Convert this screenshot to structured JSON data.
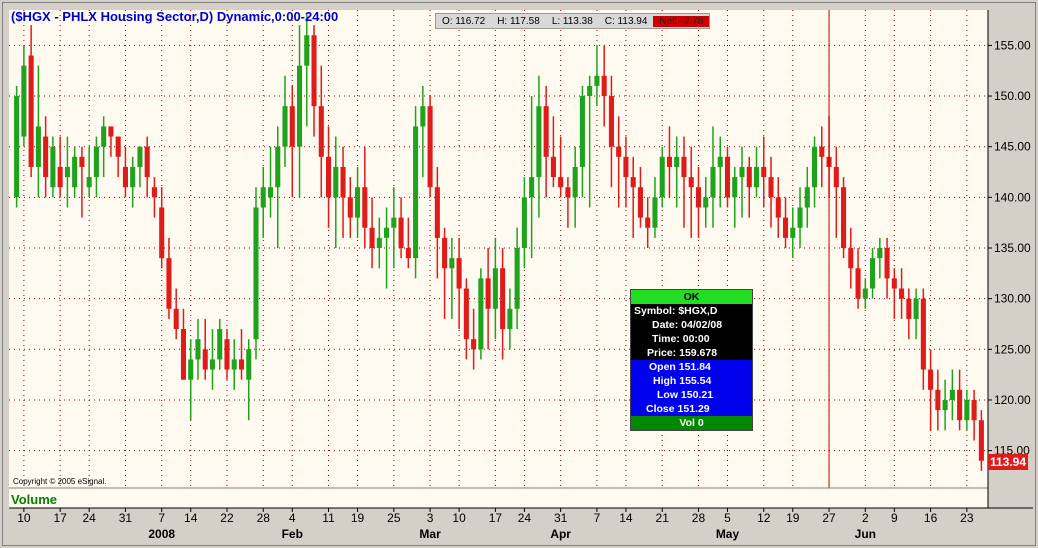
{
  "title": "($HGX - PHLX Housing Sector,D) Dynamic,0:00-24:00",
  "ohlc_bar": {
    "open": "O: 116.72",
    "high": "H: 117.58",
    "low": "L: 113.38",
    "close": "C: 113.94",
    "net": "Net: -2.78"
  },
  "copyright": "Copyright © 2005 eSignal.",
  "volume_label": "Volume",
  "last_price": "113.94",
  "cursor_panel": {
    "ok": "OK",
    "symbol": "Symbol: $HGX,D",
    "date": "Date: 04/02/08",
    "time": "Time: 00:00",
    "price": "Price: 159.678",
    "open": "Open 151.84",
    "high": "High 155.54",
    "low": "Low 150.21",
    "close": "Close 151.29",
    "vol": "Vol 0"
  },
  "colors": {
    "background": "#fffaf0",
    "up": "#1fa31f",
    "down": "#e01b1b",
    "grid": "#880000",
    "cursor_line": "#cc0000"
  },
  "chart_data": {
    "type": "candlestick",
    "ylim": [
      112,
      158
    ],
    "y_ticks": [
      115,
      120,
      125,
      130,
      135,
      140,
      145,
      150,
      155
    ],
    "y_tick_labels": [
      "115.00",
      "120.00",
      "125.00",
      "130.00",
      "135.00",
      "140.00",
      "145.00",
      "150.00",
      "155.00"
    ],
    "x_day_labels": [
      "10",
      "17",
      "24",
      "31",
      "7",
      "14",
      "22",
      "28",
      "4",
      "11",
      "19",
      "25",
      "3",
      "10",
      "17",
      "24",
      "31",
      "7",
      "14",
      "21",
      "28",
      "5",
      "12",
      "19",
      "27",
      "2",
      "9",
      "16",
      "23"
    ],
    "x_month_labels": [
      {
        "label": "2008",
        "at_day_label": 4
      },
      {
        "label": "Feb",
        "at_day_label": 8
      },
      {
        "label": "Mar",
        "at_day_label": 12
      },
      {
        "label": "Apr",
        "at_day_label": 16
      },
      {
        "label": "May",
        "at_day_label": 21
      },
      {
        "label": "Jun",
        "at_day_label": 25
      }
    ],
    "grid": true,
    "cursor_bar_index": 112,
    "candles": [
      [
        140,
        151,
        139,
        150
      ],
      [
        146,
        155,
        145,
        153
      ],
      [
        154,
        157,
        142,
        143
      ],
      [
        143,
        153,
        140,
        147
      ],
      [
        146,
        148,
        140,
        142
      ],
      [
        141,
        146,
        140,
        145
      ],
      [
        143,
        146,
        140,
        141
      ],
      [
        142,
        146,
        139,
        143
      ],
      [
        141,
        145,
        140,
        144
      ],
      [
        144,
        145,
        138,
        143
      ],
      [
        141,
        145,
        140,
        142
      ],
      [
        142,
        146,
        140,
        145
      ],
      [
        145,
        148,
        142,
        147
      ],
      [
        147,
        147,
        144,
        146
      ],
      [
        146,
        146,
        142,
        144
      ],
      [
        143,
        145,
        140,
        141
      ],
      [
        141,
        144,
        139,
        143
      ],
      [
        143,
        145,
        141,
        145
      ],
      [
        145,
        146,
        140,
        142
      ],
      [
        141,
        142,
        138,
        140
      ],
      [
        139,
        141,
        133,
        134
      ],
      [
        134,
        136,
        128,
        129
      ],
      [
        129,
        131,
        126,
        127
      ],
      [
        127,
        129,
        122,
        122
      ],
      [
        122,
        126,
        118,
        124
      ],
      [
        124,
        128,
        122,
        126
      ],
      [
        125,
        128,
        122,
        123
      ],
      [
        123,
        127,
        121,
        124
      ],
      [
        124,
        128,
        123,
        127
      ],
      [
        126,
        127,
        122,
        123
      ],
      [
        123,
        126,
        121,
        124
      ],
      [
        124,
        127,
        122,
        123
      ],
      [
        122,
        126,
        118,
        125
      ],
      [
        126,
        141,
        124,
        139
      ],
      [
        139,
        143,
        136,
        141
      ],
      [
        140,
        145,
        138,
        141
      ],
      [
        141,
        147,
        135,
        145
      ],
      [
        145,
        152,
        143,
        149
      ],
      [
        149,
        151,
        140,
        145
      ],
      [
        145,
        157,
        140,
        153
      ],
      [
        153,
        158,
        147,
        156
      ],
      [
        156,
        157,
        146,
        149
      ],
      [
        149,
        153,
        140,
        144
      ],
      [
        144,
        147,
        137,
        140
      ],
      [
        140,
        146,
        135,
        143
      ],
      [
        143,
        145,
        136,
        140
      ],
      [
        140,
        142,
        136,
        138
      ],
      [
        138,
        143,
        136,
        141
      ],
      [
        141,
        145,
        135,
        137
      ],
      [
        137,
        140,
        133,
        135
      ],
      [
        135,
        138,
        133,
        136
      ],
      [
        136,
        139,
        131,
        137
      ],
      [
        137,
        141,
        133,
        138
      ],
      [
        138,
        140,
        134,
        135
      ],
      [
        135,
        138,
        133,
        134
      ],
      [
        134,
        149,
        132,
        147
      ],
      [
        147,
        151,
        142,
        149
      ],
      [
        149,
        150,
        140,
        141
      ],
      [
        141,
        143,
        132,
        136
      ],
      [
        136,
        137,
        128,
        133
      ],
      [
        133,
        136,
        128,
        134
      ],
      [
        134,
        136,
        127,
        131
      ],
      [
        131,
        132,
        124,
        126
      ],
      [
        126,
        129,
        123,
        125
      ],
      [
        125,
        133,
        124,
        132
      ],
      [
        132,
        135,
        125,
        129
      ],
      [
        129,
        136,
        126,
        133
      ],
      [
        133,
        135,
        124,
        127
      ],
      [
        127,
        131,
        125,
        129
      ],
      [
        129,
        137,
        127,
        135
      ],
      [
        135,
        142,
        133,
        140
      ],
      [
        140,
        150,
        134,
        142
      ],
      [
        142,
        152,
        138,
        149
      ],
      [
        149,
        151,
        140,
        144
      ],
      [
        144,
        148,
        141,
        142
      ],
      [
        142,
        146,
        140,
        141
      ],
      [
        141,
        142,
        137,
        140
      ],
      [
        140,
        145,
        137,
        143
      ],
      [
        143,
        151,
        140,
        150
      ],
      [
        150,
        152,
        139,
        151
      ],
      [
        151,
        155,
        149,
        152
      ],
      [
        152,
        155,
        147,
        150
      ],
      [
        150,
        152,
        141,
        145
      ],
      [
        145,
        148,
        139,
        144
      ],
      [
        144,
        146,
        139,
        142
      ],
      [
        142,
        144,
        136,
        141
      ],
      [
        141,
        143,
        137,
        138
      ],
      [
        138,
        140,
        135,
        137
      ],
      [
        137,
        142,
        136,
        140
      ],
      [
        140,
        145,
        139,
        144
      ],
      [
        144,
        147,
        140,
        143
      ],
      [
        143,
        146,
        139,
        144
      ],
      [
        144,
        146,
        137,
        142
      ],
      [
        142,
        145,
        136,
        141
      ],
      [
        141,
        143,
        136,
        139
      ],
      [
        139,
        142,
        137,
        140
      ],
      [
        140,
        147,
        137,
        143
      ],
      [
        143,
        146,
        139,
        144
      ],
      [
        144,
        145,
        139,
        140
      ],
      [
        140,
        143,
        137,
        142
      ],
      [
        142,
        145,
        138,
        143
      ],
      [
        143,
        144,
        138,
        141
      ],
      [
        141,
        145,
        140,
        143
      ],
      [
        143,
        146,
        139,
        142
      ],
      [
        142,
        144,
        137,
        140
      ],
      [
        140,
        142,
        136,
        138
      ],
      [
        138,
        140,
        135,
        136
      ],
      [
        136,
        139,
        134,
        137
      ],
      [
        137,
        141,
        135,
        139
      ],
      [
        139,
        143,
        137,
        141
      ],
      [
        141,
        146,
        139,
        145
      ],
      [
        145,
        147,
        141,
        144
      ],
      [
        144,
        148,
        140,
        143
      ],
      [
        143,
        145,
        136,
        141
      ],
      [
        141,
        142,
        134,
        135
      ],
      [
        135,
        137,
        131,
        133
      ],
      [
        133,
        135,
        129,
        130
      ],
      [
        130,
        132,
        129,
        131
      ],
      [
        131,
        135,
        130,
        134
      ],
      [
        134,
        136,
        132,
        135
      ],
      [
        135,
        136,
        130,
        132
      ],
      [
        132,
        133,
        128,
        131
      ],
      [
        131,
        133,
        128,
        130
      ],
      [
        130,
        131,
        126,
        128
      ],
      [
        128,
        131,
        126,
        130
      ],
      [
        130,
        131,
        121,
        123
      ],
      [
        123,
        125,
        117,
        121
      ],
      [
        121,
        123,
        117,
        119
      ],
      [
        119,
        122,
        117,
        120
      ],
      [
        120,
        123,
        118,
        121
      ],
      [
        121,
        123,
        117,
        118
      ],
      [
        118,
        121,
        117,
        120
      ],
      [
        120,
        121,
        116,
        118
      ],
      [
        118,
        119,
        113,
        114
      ]
    ]
  }
}
